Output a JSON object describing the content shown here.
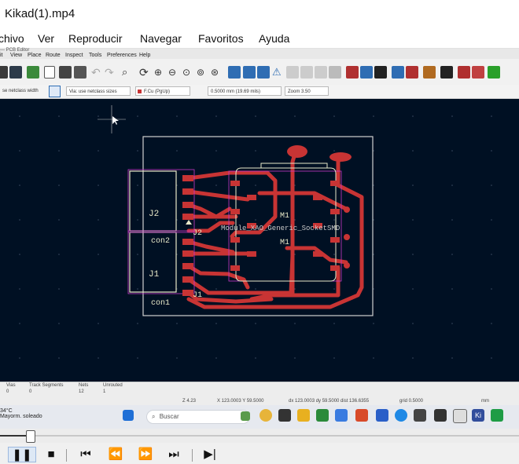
{
  "window": {
    "title": "Kikad(1).mp4"
  },
  "player_menu": [
    "chivo",
    "Ver",
    "Reproducir",
    "Navegar",
    "Favoritos",
    "Ayuda"
  ],
  "kicad": {
    "window_title": "— PCB Editor",
    "menu": [
      "it",
      "View",
      "Place",
      "Route",
      "Inspect",
      "Tools",
      "Preferences",
      "Help"
    ],
    "options": {
      "track_width": "se netclass width",
      "via_size": "Via: use netclass sizes",
      "layer": "F.Cu (PgUp)",
      "grid": "0.5000 mm (19.69 mils)",
      "zoom": "Zoom 3.50"
    },
    "board": {
      "labels": {
        "j2_body": "J2",
        "con2": "con2",
        "j1_body": "J1",
        "con1": "con1",
        "j2_ref": "J2",
        "j1_ref": "J1",
        "m1_top": "M1",
        "m1_value": "Module_XAO_Generic_SocketSMD",
        "m1_bottom": "M1"
      }
    },
    "messages": {
      "headers": [
        "Vias",
        "Track Segments",
        "Nets",
        "Unrouted"
      ],
      "values": [
        "0",
        "0",
        "12",
        "1"
      ]
    },
    "status": {
      "z": "Z 4.23",
      "xy": "X 123.0003  Y 59.5000",
      "delta": "dx 123.0003  dy 59.5000  dist 136.6355",
      "grid": "grid 0.5000",
      "units": "mm"
    }
  },
  "taskbar": {
    "temp": "34°C",
    "weather": "Mayorm. soleado",
    "search_placeholder": "Buscar"
  },
  "player_controls": {
    "pause": "❚❚",
    "stop": "■",
    "prev": "⏮",
    "rewind": "⏪",
    "forward": "⏩",
    "next": "⏭",
    "frame_step": "▶|"
  },
  "playback_progress": 0.057,
  "colors": {
    "canvas": "#001023",
    "copper": "#c83434",
    "outline": "#d0d0d0",
    "courtyard": "#c837c8",
    "silkscreen": "#e8e8c8"
  }
}
